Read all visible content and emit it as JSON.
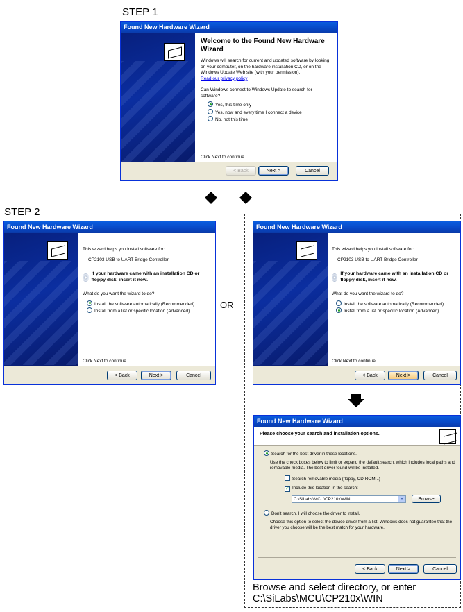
{
  "step1_label": "STEP 1",
  "step2_label": "STEP 2",
  "or_label": "OR",
  "caption_line1": "Browse and select directory, or enter",
  "caption_line2": "C:\\SiLabs\\MCU\\CP210x\\WIN",
  "win1": {
    "title": "Found New Hardware Wizard",
    "heading": "Welcome to the Found New Hardware Wizard",
    "intro": "Windows will search for current and updated software by looking on your computer, on the hardware installation CD, or on the Windows Update Web site (with your permission).",
    "privacy_link": "Read our privacy policy",
    "question": "Can Windows connect to Windows Update to search for software?",
    "options": [
      "Yes, this time only",
      "Yes, now and every time I connect a device",
      "No, not this time"
    ],
    "click_next": "Click Next to continue.",
    "back": "< Back",
    "next": "Next >",
    "cancel": "Cancel"
  },
  "win2": {
    "title": "Found New Hardware Wizard",
    "helps": "This wizard helps you install software for:",
    "device": "CP2103 USB to UART Bridge Controller",
    "cd_note": "If your hardware came with an installation CD or floppy disk, insert it now.",
    "question": "What do you want the wizard to do?",
    "options": [
      "Install the software automatically (Recommended)",
      "Install from a list or specific location (Advanced)"
    ],
    "click_next": "Click Next to continue.",
    "back": "< Back",
    "next": "Next >",
    "cancel": "Cancel"
  },
  "win3": {
    "title": "Found New Hardware Wizard",
    "helps": "This wizard helps you install software for:",
    "device": "CP2103 USB to UART Bridge Controller",
    "cd_note": "If your hardware came with an installation CD or floppy disk, insert it now.",
    "question": "What do you want the wizard to do?",
    "options": [
      "Install the software automatically (Recommended)",
      "Install from a list or specific location (Advanced)"
    ],
    "click_next": "Click Next to continue.",
    "back": "< Back",
    "next": "Next >",
    "cancel": "Cancel"
  },
  "win4": {
    "title": "Found New Hardware Wizard",
    "heading": "Please choose your search and installation options.",
    "search_option": "Search for the best driver in these locations.",
    "search_desc": "Use the check boxes below to limit or expand the default search, which includes local paths and removable media. The best driver found will be installed.",
    "removable": "Search removable media (floppy, CD-ROM...)",
    "include": "Include this location in the search:",
    "path": "C:\\SiLabs\\MCU\\CP210x\\WIN",
    "browse": "Browse",
    "dont_search": "Don't search. I will choose the driver to install.",
    "dont_desc": "Choose this option to select the device driver from a list. Windows does not guarantee that the driver you choose will be the best match for your hardware.",
    "back": "< Back",
    "next": "Next >",
    "cancel": "Cancel"
  }
}
